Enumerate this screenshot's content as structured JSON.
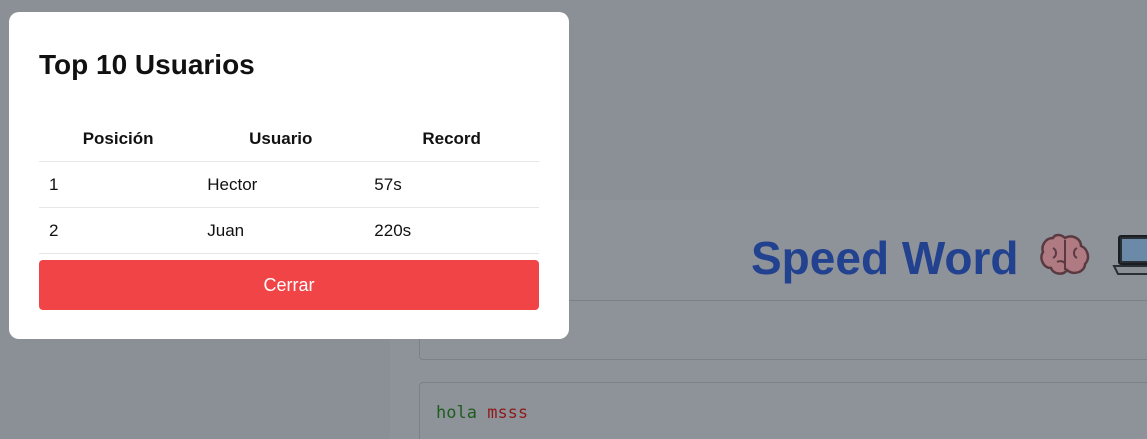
{
  "background": {
    "app_title": "Speed Word",
    "icons": [
      "brain-icon",
      "laptop-icon"
    ],
    "typed_text": {
      "correct": "hola",
      "separator": " ",
      "incorrect": "msss"
    }
  },
  "modal": {
    "title": "Top 10 Usuarios",
    "table": {
      "headers": [
        "Posición",
        "Usuario",
        "Record"
      ],
      "rows": [
        [
          "1",
          "Hector",
          "57s"
        ],
        [
          "2",
          "Juan",
          "220s"
        ]
      ]
    },
    "close_label": "Cerrar"
  },
  "colors": {
    "title_blue": "#22418f",
    "close_button": "#f04447",
    "overlay": "#8b9097"
  }
}
